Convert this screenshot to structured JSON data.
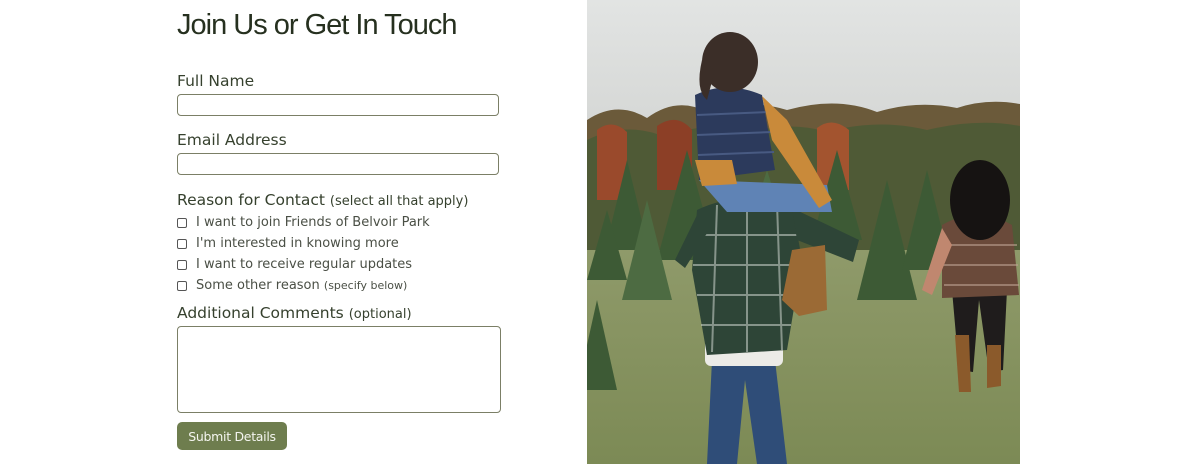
{
  "form": {
    "title": "Join Us or Get In Touch",
    "full_name_label": "Full Name",
    "email_label": "Email Address",
    "reason_label": "Reason for Contact",
    "reason_hint": "(select all that apply)",
    "options": [
      {
        "label": "I want to join Friends of Belvoir Park",
        "hint": "",
        "checked": false
      },
      {
        "label": "I'm interested in knowing more",
        "hint": "",
        "checked": false
      },
      {
        "label": "I want to receive regular updates",
        "hint": "",
        "checked": false
      },
      {
        "label": "Some other reason",
        "hint": "(specify below)",
        "checked": false
      }
    ],
    "comments_label": "Additional Comments",
    "comments_hint": "(optional)",
    "submit_label": "Submit Details"
  },
  "colors": {
    "accent": "#6e7d4e",
    "input_border": "#7b7f66",
    "title": "#26301f"
  },
  "icons": [
    "checkbox-icon"
  ]
}
